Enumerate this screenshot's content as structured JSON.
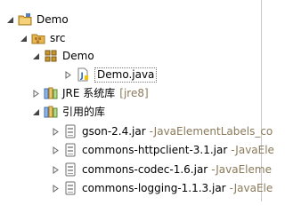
{
  "tree": {
    "project": {
      "label": "Demo"
    },
    "src": {
      "label": "src"
    },
    "package": {
      "label": "Demo"
    },
    "file": {
      "label": "Demo.java"
    },
    "jre": {
      "label": "JRE 系统库",
      "suffix": "[jre8]"
    },
    "libs": {
      "label": "引用的库"
    },
    "jars": [
      {
        "label": "gson-2.4.jar",
        "suffix": "-JavaElementLabels_co"
      },
      {
        "label": "commons-httpclient-3.1.jar",
        "suffix": "-JavaEle"
      },
      {
        "label": "commons-codec-1.6.jar",
        "suffix": "-JavaEleme"
      },
      {
        "label": "commons-logging-1.1.3.jar",
        "suffix": "-JavaEle"
      }
    ]
  },
  "icons": [
    "project-folder-icon",
    "source-folder-icon",
    "package-icon",
    "java-file-icon",
    "library-icon",
    "jar-icon"
  ],
  "colors": {
    "accent_orange": "#c8962b",
    "package_brown": "#b47a2f",
    "java_blue": "#2f6fb6",
    "muted_text": "#8a7a5a"
  }
}
